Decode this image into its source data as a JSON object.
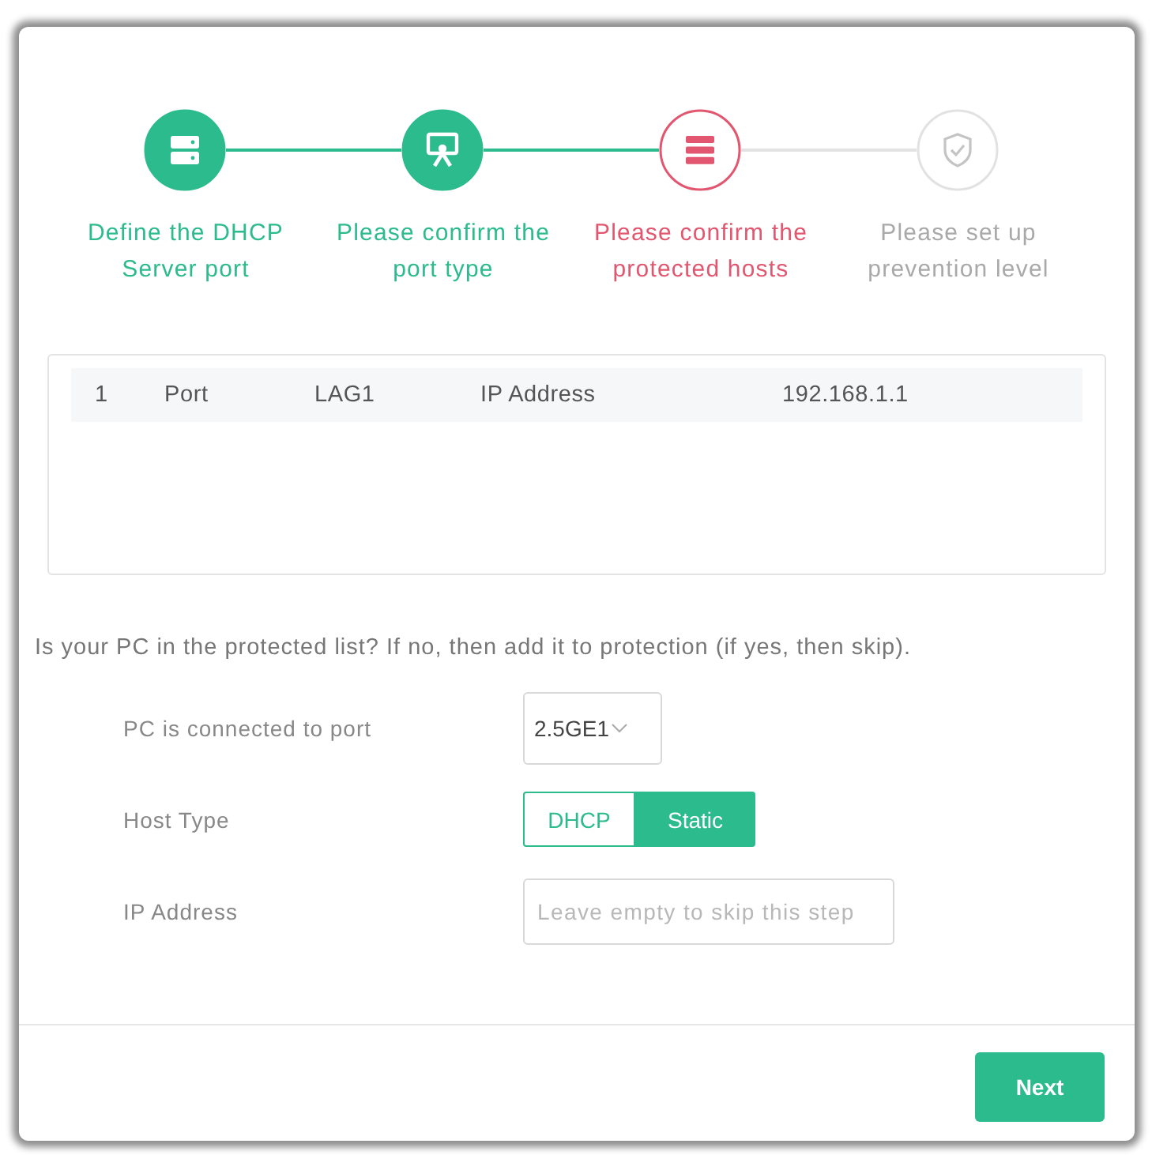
{
  "steps": [
    {
      "label": "Define the DHCP Server port",
      "completed": true,
      "selected": false
    },
    {
      "label": "Please confirm the port type",
      "completed": true,
      "selected": false
    },
    {
      "label": "Please confirm the protected hosts",
      "completed": false,
      "selected": true
    },
    {
      "label": "Please set up prevention level",
      "completed": false,
      "selected": false
    }
  ],
  "hosts_table": {
    "rows": [
      {
        "cells": [
          "1",
          "Port",
          "LAG1",
          "IP Address",
          "192.168.1.1"
        ]
      }
    ]
  },
  "question": "Is your PC in the protected list? If no, then add it to protection (if yes, then skip).",
  "form": {
    "port": {
      "label": "PC is connected to port",
      "value": "2.5GE1"
    },
    "host_type": {
      "label": "Host Type",
      "options": [
        {
          "label": "DHCP",
          "selected": false
        },
        {
          "label": "Static",
          "selected": true
        }
      ]
    },
    "ip_address": {
      "label": "IP Address",
      "placeholder": "Leave empty to skip this step"
    }
  },
  "footer": {
    "button": "Next"
  }
}
